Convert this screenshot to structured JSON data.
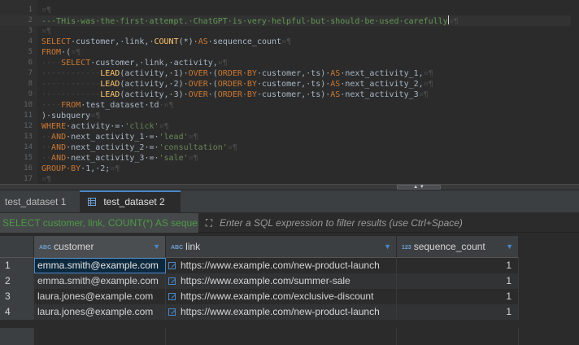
{
  "editor": {
    "lines": [
      {
        "num": "1",
        "segments": [
          {
            "c": "ws",
            "t": "¤¶"
          }
        ]
      },
      {
        "num": "2",
        "segments": [
          {
            "c": "cmt",
            "t": "--·THis·was·the·first·attempt.·ChatGPT·is·very·helpful·but·should·be·used·carefully"
          },
          {
            "c": "caret",
            "t": ""
          },
          {
            "c": "ws",
            "t": "¤¶"
          }
        ],
        "current": true
      },
      {
        "num": "3",
        "segments": [
          {
            "c": "ws",
            "t": "¤¶"
          }
        ]
      },
      {
        "num": "4",
        "segments": [
          {
            "c": "kw",
            "t": "SELECT"
          },
          {
            "c": "tx",
            "t": "·customer,·link,·"
          },
          {
            "c": "fn",
            "t": "COUNT"
          },
          {
            "c": "tx",
            "t": "(*)·"
          },
          {
            "c": "kw",
            "t": "AS"
          },
          {
            "c": "tx",
            "t": "·sequence_count"
          },
          {
            "c": "ws",
            "t": "¤¶"
          }
        ]
      },
      {
        "num": "5",
        "segments": [
          {
            "c": "kw",
            "t": "FROM"
          },
          {
            "c": "tx",
            "t": "·("
          },
          {
            "c": "ws",
            "t": "¤¶"
          }
        ]
      },
      {
        "num": "6",
        "segments": [
          {
            "c": "ws",
            "t": "····"
          },
          {
            "c": "kw",
            "t": "SELECT"
          },
          {
            "c": "tx",
            "t": "·customer,·link,·activity,"
          },
          {
            "c": "ws",
            "t": "¤¶"
          }
        ]
      },
      {
        "num": "7",
        "segments": [
          {
            "c": "ws",
            "t": "············"
          },
          {
            "c": "fn",
            "t": "LEAD"
          },
          {
            "c": "tx",
            "t": "(activity,·1)·"
          },
          {
            "c": "kw",
            "t": "OVER"
          },
          {
            "c": "tx",
            "t": "·("
          },
          {
            "c": "kw",
            "t": "ORDER·BY"
          },
          {
            "c": "tx",
            "t": "·customer,·ts)·"
          },
          {
            "c": "kw",
            "t": "AS"
          },
          {
            "c": "tx",
            "t": "·next_activity_1,"
          },
          {
            "c": "ws",
            "t": "¤¶"
          }
        ]
      },
      {
        "num": "8",
        "segments": [
          {
            "c": "ws",
            "t": "············"
          },
          {
            "c": "fn",
            "t": "LEAD"
          },
          {
            "c": "tx",
            "t": "(activity,·2)·"
          },
          {
            "c": "kw",
            "t": "OVER"
          },
          {
            "c": "tx",
            "t": "·("
          },
          {
            "c": "kw",
            "t": "ORDER·BY"
          },
          {
            "c": "tx",
            "t": "·customer,·ts)·"
          },
          {
            "c": "kw",
            "t": "AS"
          },
          {
            "c": "tx",
            "t": "·next_activity_2,"
          },
          {
            "c": "ws",
            "t": "¤¶"
          }
        ]
      },
      {
        "num": "9",
        "segments": [
          {
            "c": "ws",
            "t": "············"
          },
          {
            "c": "fn",
            "t": "LEAD"
          },
          {
            "c": "tx",
            "t": "(activity,·3)·"
          },
          {
            "c": "kw",
            "t": "OVER"
          },
          {
            "c": "tx",
            "t": "·("
          },
          {
            "c": "kw",
            "t": "ORDER·BY"
          },
          {
            "c": "tx",
            "t": "·customer,·ts)·"
          },
          {
            "c": "kw",
            "t": "AS"
          },
          {
            "c": "tx",
            "t": "·next_activity_3"
          },
          {
            "c": "ws",
            "t": "¤¶"
          }
        ]
      },
      {
        "num": "10",
        "segments": [
          {
            "c": "ws",
            "t": "····"
          },
          {
            "c": "kw",
            "t": "FROM"
          },
          {
            "c": "tx",
            "t": "·test_dataset·td"
          },
          {
            "c": "ws",
            "t": "·¤¶"
          }
        ]
      },
      {
        "num": "11",
        "segments": [
          {
            "c": "tx",
            "t": ")·subquery"
          },
          {
            "c": "ws",
            "t": "¤¶"
          }
        ]
      },
      {
        "num": "12",
        "segments": [
          {
            "c": "kw",
            "t": "WHERE"
          },
          {
            "c": "tx",
            "t": "·activity·=·"
          },
          {
            "c": "str",
            "t": "'click'"
          },
          {
            "c": "ws",
            "t": "¤¶"
          }
        ]
      },
      {
        "num": "13",
        "segments": [
          {
            "c": "ws",
            "t": "··"
          },
          {
            "c": "kw",
            "t": "AND"
          },
          {
            "c": "tx",
            "t": "·next_activity_1·=·"
          },
          {
            "c": "str",
            "t": "'lead'"
          },
          {
            "c": "ws",
            "t": "¤¶"
          }
        ]
      },
      {
        "num": "14",
        "segments": [
          {
            "c": "ws",
            "t": "··"
          },
          {
            "c": "kw",
            "t": "AND"
          },
          {
            "c": "tx",
            "t": "·next_activity_2·=·"
          },
          {
            "c": "str",
            "t": "'consultation'"
          },
          {
            "c": "ws",
            "t": "¤¶"
          }
        ]
      },
      {
        "num": "15",
        "segments": [
          {
            "c": "ws",
            "t": "··"
          },
          {
            "c": "kw",
            "t": "AND"
          },
          {
            "c": "tx",
            "t": "·next_activity_3·=·"
          },
          {
            "c": "str",
            "t": "'sale'"
          },
          {
            "c": "ws",
            "t": "¤¶"
          }
        ]
      },
      {
        "num": "16",
        "segments": [
          {
            "c": "kw",
            "t": "GROUP·BY"
          },
          {
            "c": "tx",
            "t": "·1,·2;"
          },
          {
            "c": "ws",
            "t": "¤¶"
          }
        ]
      },
      {
        "num": "17",
        "segments": [
          {
            "c": "ws",
            "t": "¤¶"
          }
        ]
      }
    ]
  },
  "tabs": [
    {
      "label": "test_dataset 1",
      "active": false
    },
    {
      "label": "test_dataset 2",
      "active": true,
      "close": "×"
    }
  ],
  "filter": {
    "sql_text": "SELECT customer, link, COUNT(*) AS sequenc",
    "expand_icon": "⛶",
    "placeholder": "Enter a SQL expression to filter results (use Ctrl+Space)"
  },
  "grid": {
    "columns": [
      {
        "key": "customer",
        "label": "customer",
        "type_badge": "ABC"
      },
      {
        "key": "link",
        "label": "link",
        "type_badge": "ABC"
      },
      {
        "key": "sequence_count",
        "label": "sequence_count",
        "type_badge": "123"
      }
    ],
    "rows": [
      {
        "num": "1",
        "customer": "emma.smith@example.com",
        "link": "https://www.example.com/new-product-launch",
        "sequence_count": "1"
      },
      {
        "num": "2",
        "customer": "emma.smith@example.com",
        "link": "https://www.example.com/summer-sale",
        "sequence_count": "1"
      },
      {
        "num": "3",
        "customer": "laura.jones@example.com",
        "link": "https://www.example.com/exclusive-discount",
        "sequence_count": "1"
      },
      {
        "num": "4",
        "customer": "laura.jones@example.com",
        "link": "https://www.example.com/new-product-launch",
        "sequence_count": "1"
      }
    ]
  },
  "colors": {
    "keyword": "#cc7832",
    "function": "#ffc66d",
    "string": "#6a8759",
    "comment": "#629755",
    "accent": "#4a88c7",
    "filter_sql": "#4e9a45"
  }
}
